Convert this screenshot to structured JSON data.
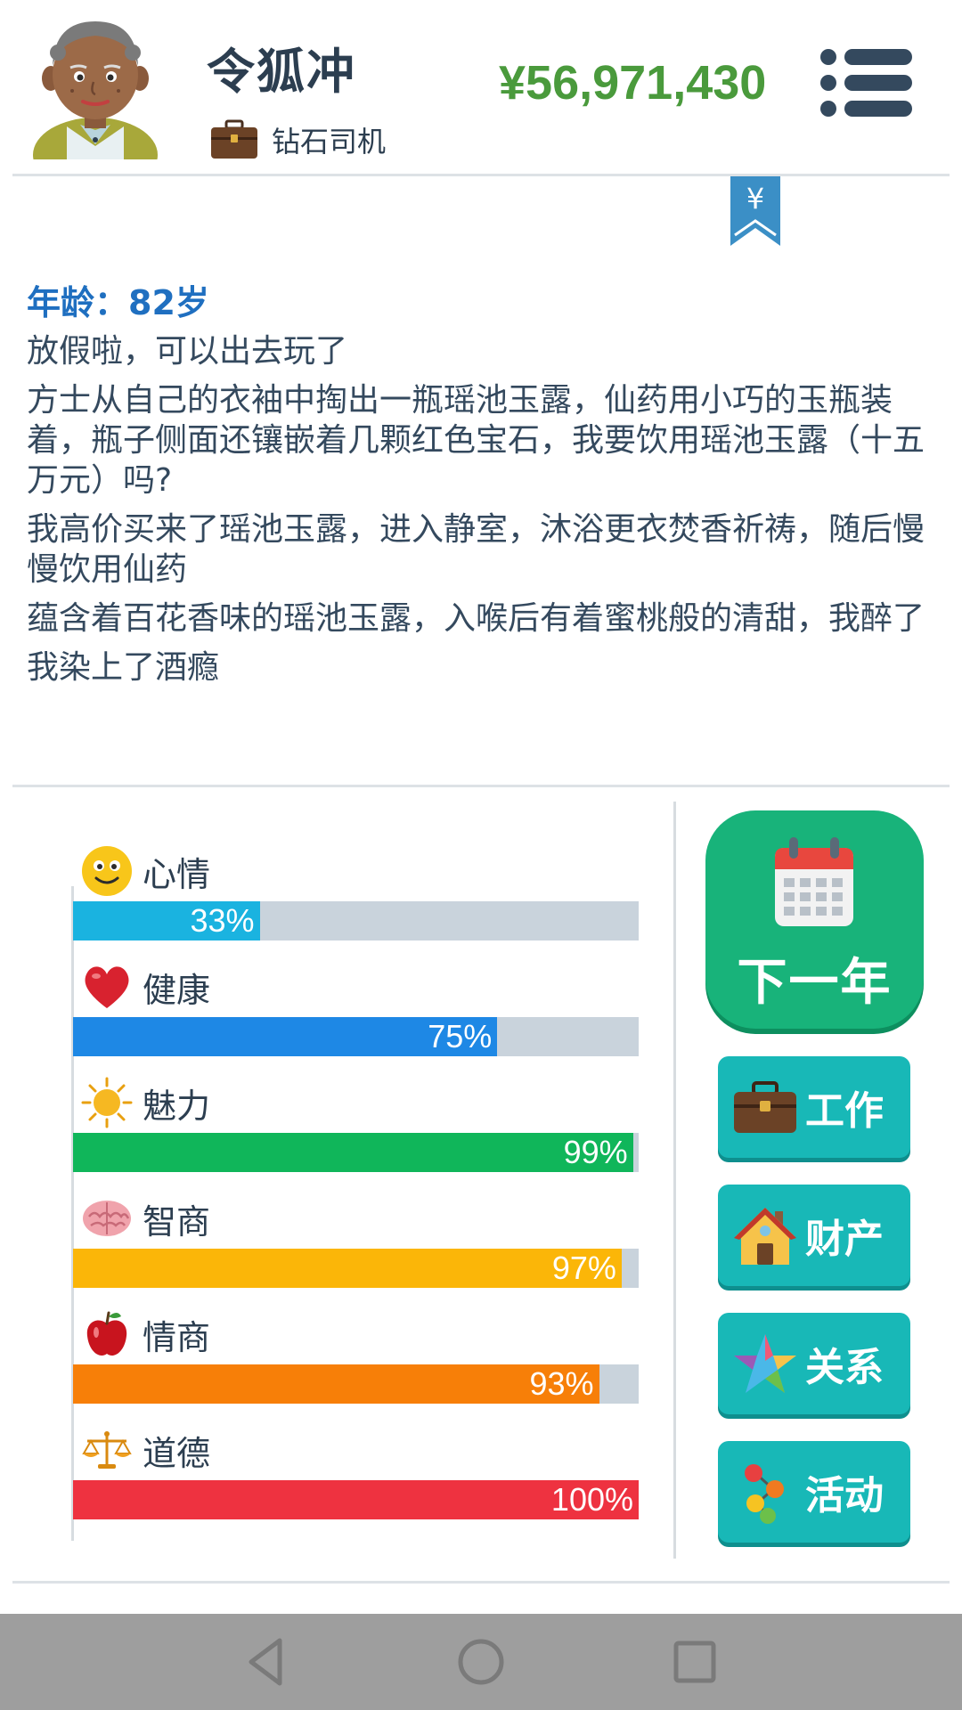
{
  "header": {
    "player_name": "令狐冲",
    "job_title": "钻石司机",
    "money": "¥56,971,430",
    "menu_icon": "hamburger-menu-icon"
  },
  "log": {
    "age_line": "年龄：82岁",
    "entries": [
      "放假啦，可以出去玩了",
      "方士从自己的衣袖中掏出一瓶瑶池玉露，仙药用小巧的玉瓶装着，瓶子侧面还镶嵌着几颗红色宝石，我要饮用瑶池玉露（十五万元）吗?",
      "我高价买来了瑶池玉露，进入静室，沐浴更衣焚香祈祷，随后慢慢饮用仙药",
      "蕴含着百花香味的瑶池玉露，入喉后有着蜜桃般的清甜，我醉了",
      "我染上了酒瘾"
    ]
  },
  "stats": [
    {
      "label": "心情",
      "value": 33,
      "value_text": "33%",
      "color": "#1ab3e0",
      "icon": "smiley-face-icon"
    },
    {
      "label": "健康",
      "value": 75,
      "value_text": "75%",
      "color": "#1e88e5",
      "icon": "heart-icon"
    },
    {
      "label": "魅力",
      "value": 99,
      "value_text": "99%",
      "color": "#10b65a",
      "icon": "sun-icon"
    },
    {
      "label": "智商",
      "value": 97,
      "value_text": "97%",
      "color": "#fbb608",
      "icon": "brain-icon"
    },
    {
      "label": "情商",
      "value": 93,
      "value_text": "93%",
      "color": "#f77f08",
      "icon": "apple-icon"
    },
    {
      "label": "道德",
      "value": 100,
      "value_text": "100%",
      "color": "#ee3240",
      "icon": "scales-icon"
    }
  ],
  "actions": {
    "next_year": "下一年",
    "work": "工作",
    "property": "财产",
    "relations": "关系",
    "activities": "活动"
  },
  "colors": {
    "money": "#4a9a3c",
    "age": "#1f6fc0",
    "next_year_bg": "#18b37a",
    "action_bg": "#18b8b7",
    "track_bg": "#c9d3dc"
  }
}
